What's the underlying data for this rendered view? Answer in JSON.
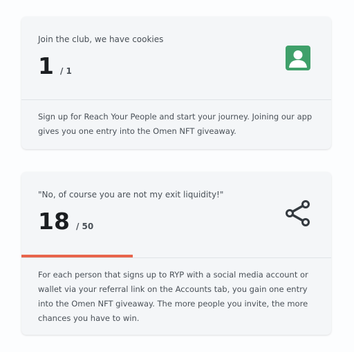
{
  "cards": [
    {
      "subtitle": "Join the club, we have cookies",
      "value": "1",
      "total": "/ 1",
      "description_lines": [
        "Sign up for Reach Your People and start your journey. Joining our app",
        "gives you one entry into the Omen NFT giveaway."
      ],
      "icon": "user-profile-icon",
      "icon_color": "#3fa06a"
    },
    {
      "subtitle": "\"No, of course you are not my exit liquidity!\"",
      "value": "18",
      "total": "/ 50",
      "progress_fraction": 0.36,
      "progress_color": "#e8654c",
      "description_lines": [
        "For each person that signs up to RYP with a social media account or",
        "wallet via your referral link on the Accounts tab, you gain one entry",
        "into the Omen NFT giveaway. The more people you invite, the more",
        "chances you have to win."
      ],
      "icon": "share-icon",
      "icon_color": "#343a40"
    }
  ]
}
